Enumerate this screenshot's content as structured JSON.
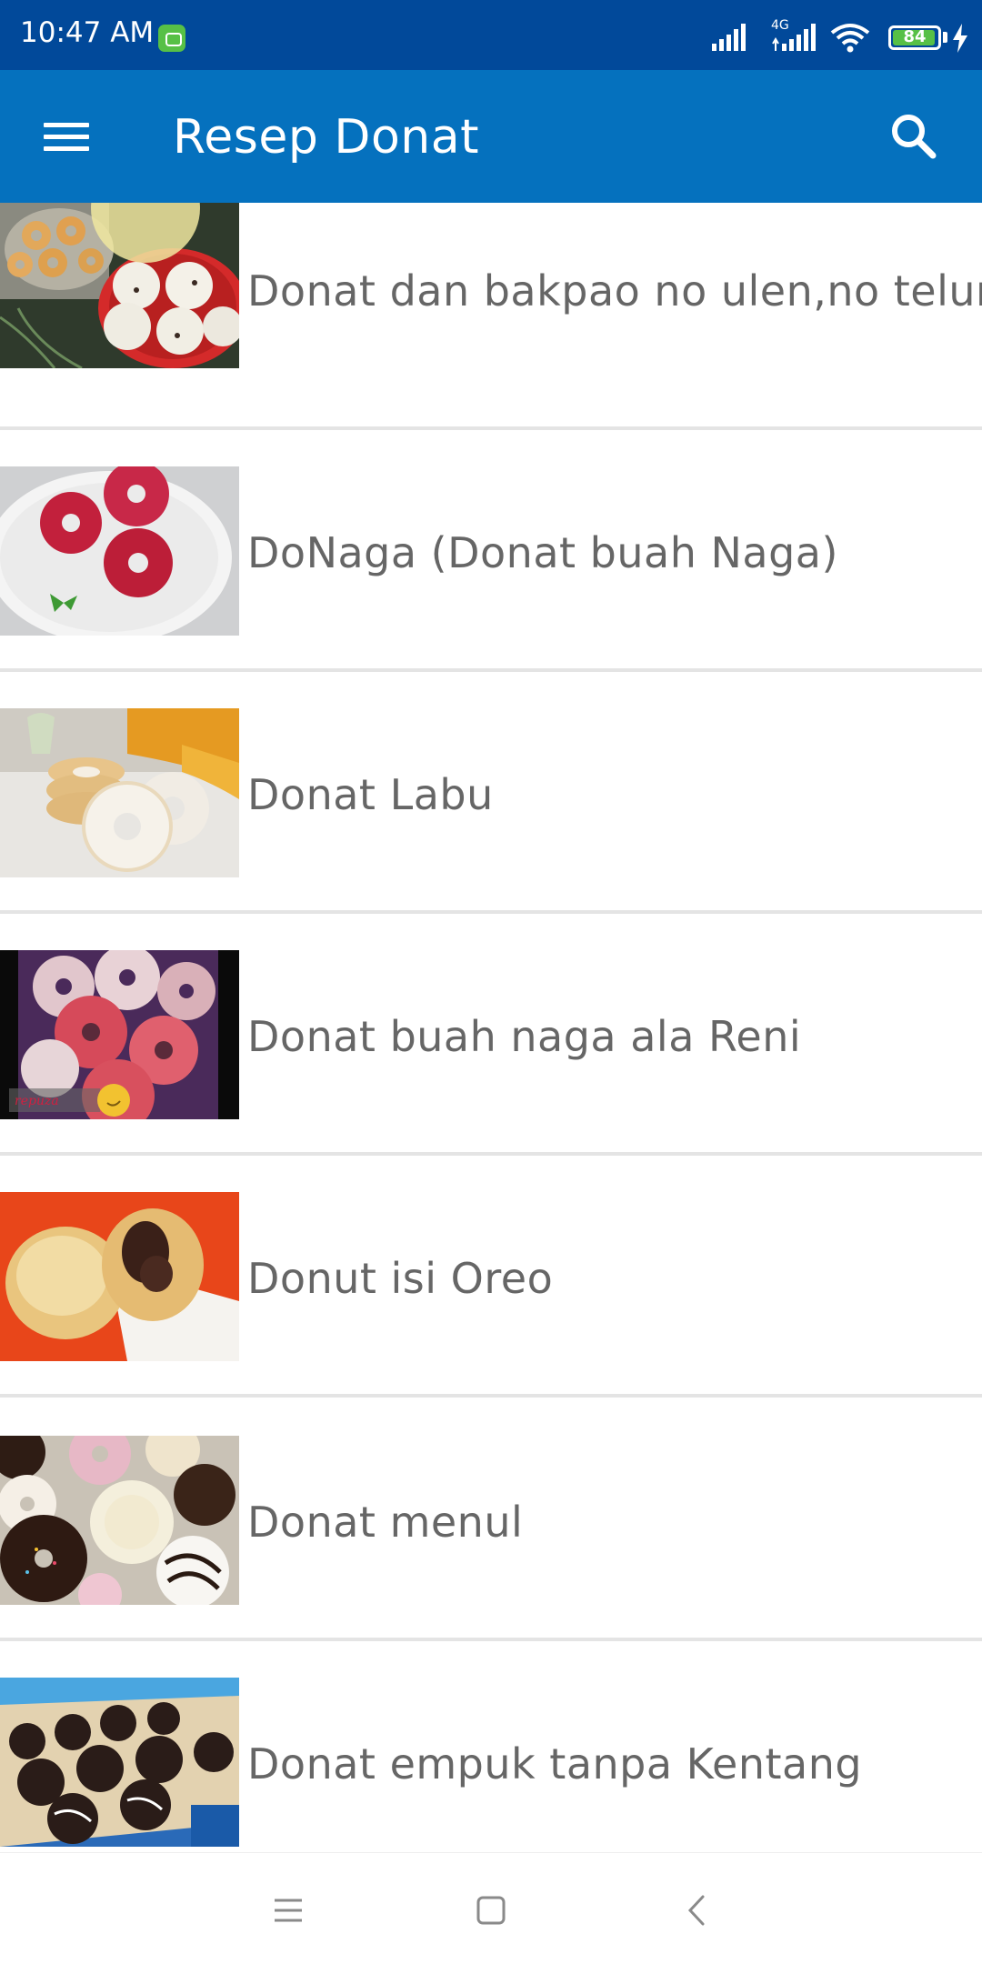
{
  "status": {
    "time": "10:47 AM",
    "network": "4G",
    "battery": "84",
    "app_icon": "chat-app-icon",
    "icons": [
      "signal-icon",
      "4g-signal-icon",
      "wifi-icon",
      "battery-icon",
      "charging-icon"
    ]
  },
  "app_bar": {
    "title": "Resep Donat",
    "menu_icon": "hamburger-menu-icon",
    "search_icon": "search-icon",
    "color": "#0571be"
  },
  "recipes": [
    {
      "title": "Donat dan bakpao no ulen,no telur",
      "image": "donut-and-bakpao-photo"
    },
    {
      "title": "DoNaga (Donat buah Naga)",
      "image": "dragon-fruit-donut-photo"
    },
    {
      "title": "Donat Labu",
      "image": "pumpkin-donut-photo"
    },
    {
      "title": "Donat buah naga ala Reni",
      "image": "sugared-red-donut-photo"
    },
    {
      "title": "Donut isi Oreo",
      "image": "oreo-filled-donut-photo"
    },
    {
      "title": "Donat menul",
      "image": "topped-donuts-tray-photo"
    },
    {
      "title": "Donat empuk tanpa Kentang",
      "image": "chocolate-donuts-photo"
    }
  ],
  "nav_bar": {
    "icons": [
      "recent-apps-icon",
      "home-icon",
      "back-icon"
    ]
  },
  "colors": {
    "status_bar": "#01499a",
    "app_bar": "#0571be",
    "item_text": "#666666",
    "divider": "#e4e4e4"
  }
}
